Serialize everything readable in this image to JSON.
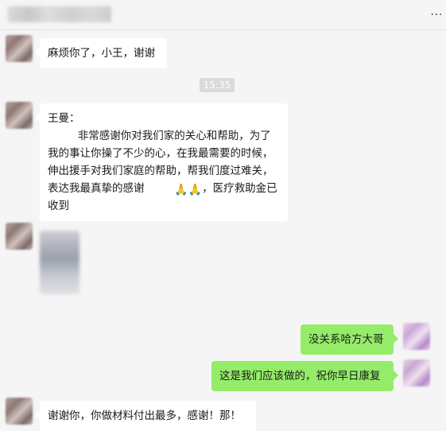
{
  "header": {
    "more_icon": "⋯"
  },
  "messages": [
    {
      "side": "left",
      "text": "麻烦你了，小王，谢谢"
    },
    {
      "type": "time",
      "text": "15:35"
    },
    {
      "side": "left",
      "line1": "王曼：",
      "body_text_a": "非常感谢你对我们家的关心和帮助，为了我的事让你操了不少的心，在我最需要的时候，伸出援手对我们家庭的帮助，帮我们度过难关，表达我最真挚的感谢",
      "emoji": "🙏🙏",
      "body_text_b": "，医疗救助金已收到"
    },
    {
      "side": "left",
      "type": "image"
    },
    {
      "side": "right",
      "text": "没关系哈方大哥"
    },
    {
      "side": "right",
      "text": "这是我们应该做的，祝你早日康复"
    },
    {
      "side": "left",
      "text": "谢谢你，你做材料付出最多，感谢！那！"
    }
  ],
  "colors": {
    "self_bubble": "#95ec69",
    "other_bubble": "#ffffff",
    "background": "#f5f5f5"
  }
}
